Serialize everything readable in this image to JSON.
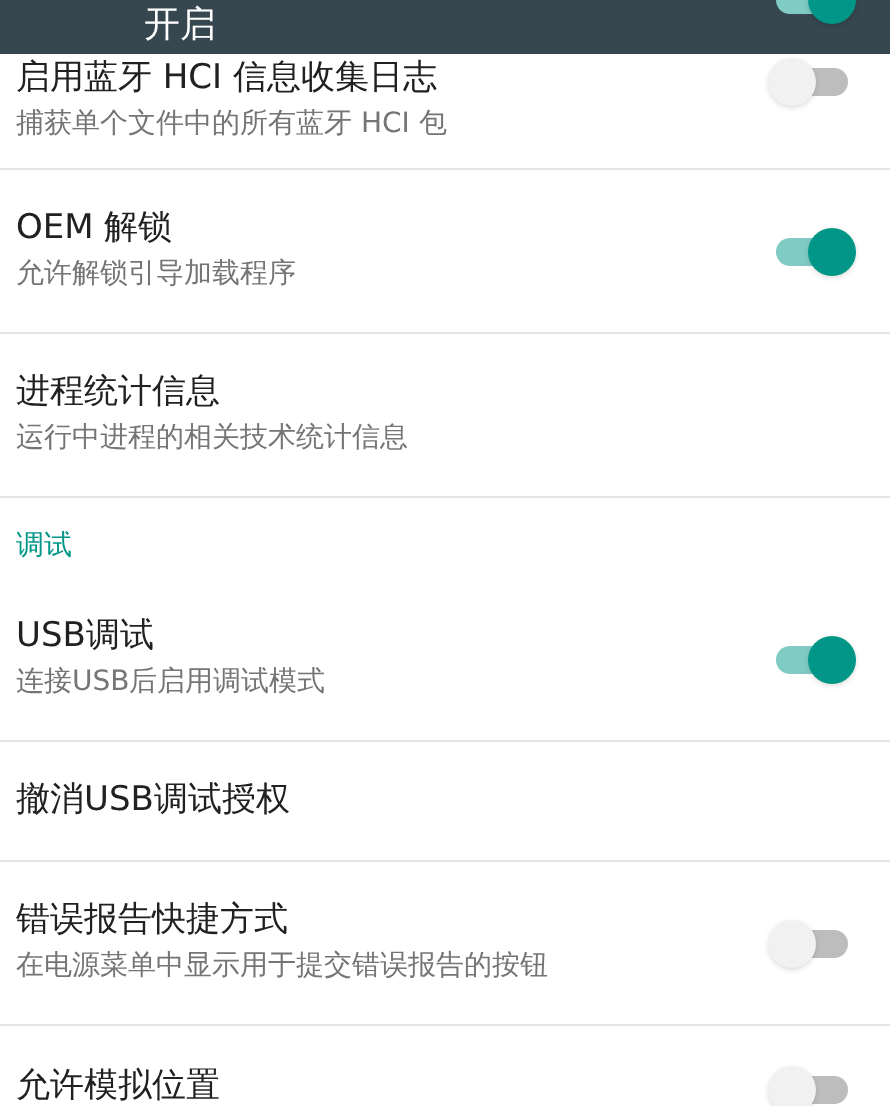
{
  "top_bar": {
    "title": "开启",
    "on": true
  },
  "items": [
    {
      "kind": "switch",
      "title": "启用蓝牙 HCI 信息收集日志",
      "summary": "捕获单个文件中的所有蓝牙 HCI 包",
      "on": false
    },
    {
      "kind": "switch",
      "title": "OEM 解锁",
      "summary": "允许解锁引导加载程序",
      "on": true
    },
    {
      "kind": "text",
      "title": "进程统计信息",
      "summary": "运行中进程的相关技术统计信息"
    },
    {
      "kind": "section",
      "title": "调试"
    },
    {
      "kind": "switch",
      "title": "USB调试",
      "summary": "连接USB后启用调试模式",
      "on": true
    },
    {
      "kind": "text",
      "title": "撤消USB调试授权"
    },
    {
      "kind": "switch",
      "title": "错误报告快捷方式",
      "summary": "在电源菜单中显示用于提交错误报告的按钮",
      "on": false
    },
    {
      "kind": "switch",
      "title": "允许模拟位置",
      "on": false
    }
  ]
}
